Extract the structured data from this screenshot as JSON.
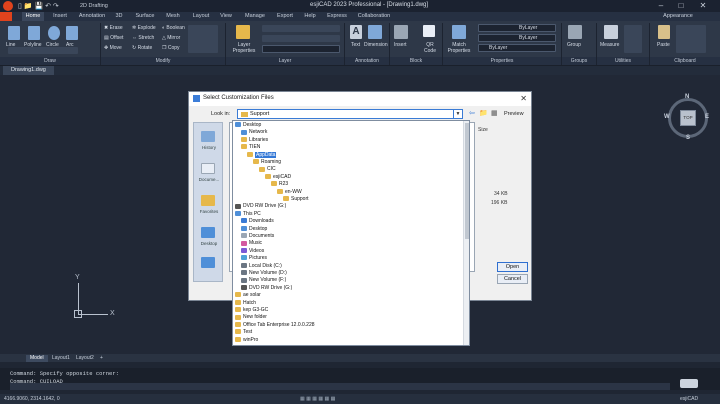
{
  "app": {
    "title": "esjiCAD 2023 Professional - [Drawing1.dwg]",
    "workspace": "2D Drafting",
    "appearance": "Appearance"
  },
  "menu_tabs": [
    "Home",
    "Insert",
    "Annotation",
    "3D",
    "Surface",
    "Mesh",
    "Layout",
    "View",
    "Manage",
    "Export",
    "Help",
    "Express",
    "Collaboration"
  ],
  "ribbon": {
    "draw": [
      "Line",
      "Polyline",
      "Circle",
      "Arc"
    ],
    "modify_col1": [
      "Erase",
      "Offset",
      "Move"
    ],
    "modify_col2": [
      "Explode",
      "Stretch",
      "Rotate"
    ],
    "modify_col3": [
      "Boolean",
      "Mirror",
      "Copy"
    ],
    "layer_label": "Layer Properties",
    "annotation": [
      "Text",
      "Dimension"
    ],
    "block": [
      "Insert",
      "QR Code"
    ],
    "match_label": "Match Properties",
    "bylayer": [
      "ByLayer",
      "ByLayer",
      "ByLayer"
    ],
    "right": [
      "Group",
      "Measure",
      "Paste"
    ],
    "groups": [
      "Draw",
      "Modify",
      "Layer",
      "Annotation",
      "Block",
      "Properties",
      "Groups",
      "Utilities",
      "Clipboard"
    ]
  },
  "document_tab": "Drawing1.dwg",
  "layout_tabs": [
    "Model",
    "Layout1",
    "Layout2",
    "+"
  ],
  "command_history": [
    "Command: Specify opposite corner:",
    "Command: CUILOAD"
  ],
  "status": {
    "coords": "4166.9060, 2314.1642, 0",
    "app": "esjiCAD"
  },
  "viewcube": {
    "top": "TOP",
    "n": "N",
    "s": "S",
    "e": "E",
    "w": "W"
  },
  "dialog": {
    "title": "Select Customization Files",
    "look_in_label": "Look in:",
    "look_in_value": "Support",
    "preview": "Preview",
    "size_header": "Size",
    "sizes": [
      "34 KB",
      "196 KB"
    ],
    "open": "Open",
    "cancel": "Cancel",
    "sidebar": [
      "History",
      "Docume...",
      "Favorites",
      "Desktop"
    ]
  },
  "tree": [
    {
      "label": "Desktop",
      "level": 0,
      "color": "#4f8fd8"
    },
    {
      "label": "Network",
      "level": 1,
      "color": "#4f8fd8"
    },
    {
      "label": "Libraries",
      "level": 1,
      "color": "#e6b84b"
    },
    {
      "label": "TIEN",
      "level": 1,
      "color": "#e6b84b"
    },
    {
      "label": "AppData",
      "level": 2,
      "color": "#e6b84b",
      "selected": true
    },
    {
      "label": "Roaming",
      "level": 3,
      "color": "#e6b84b"
    },
    {
      "label": "CIC",
      "level": 4,
      "color": "#e6b84b"
    },
    {
      "label": "esjiCAD",
      "level": 5,
      "color": "#e6b84b"
    },
    {
      "label": "R23",
      "level": 6,
      "color": "#e6b84b"
    },
    {
      "label": "en-WW",
      "level": 7,
      "color": "#e6b84b"
    },
    {
      "label": "Support",
      "level": 8,
      "color": "#e6b84b"
    },
    {
      "label": "DVD RW Drive (G:)",
      "level": 0,
      "color": "#555555"
    },
    {
      "label": "This PC",
      "level": 0,
      "color": "#4f8fd8"
    },
    {
      "label": "Downloads",
      "level": 1,
      "color": "#3a7bd5"
    },
    {
      "label": "Desktop",
      "level": 1,
      "color": "#4f8fd8"
    },
    {
      "label": "Documents",
      "level": 1,
      "color": "#9aa6b4"
    },
    {
      "label": "Music",
      "level": 1,
      "color": "#d45aa0"
    },
    {
      "label": "Videos",
      "level": 1,
      "color": "#7b5ad6"
    },
    {
      "label": "Pictures",
      "level": 1,
      "color": "#4fa3d8"
    },
    {
      "label": "Local Disk (C:)",
      "level": 1,
      "color": "#6b7683"
    },
    {
      "label": "New Volume (D:)",
      "level": 1,
      "color": "#6b7683"
    },
    {
      "label": "New Volume (F:)",
      "level": 1,
      "color": "#6b7683"
    },
    {
      "label": "DVD RW Drive (G:)",
      "level": 1,
      "color": "#555555"
    },
    {
      "label": "ae solar",
      "level": 0,
      "color": "#e6b84b"
    },
    {
      "label": "Hatch",
      "level": 0,
      "color": "#e6b84b"
    },
    {
      "label": "kep G3-GC",
      "level": 0,
      "color": "#e6b84b"
    },
    {
      "label": "New folder",
      "level": 0,
      "color": "#e6b84b"
    },
    {
      "label": "Office Tab Enterprise 12.0.0.228",
      "level": 0,
      "color": "#e6b84b"
    },
    {
      "label": "Test",
      "level": 0,
      "color": "#e6b84b"
    },
    {
      "label": "winPro",
      "level": 0,
      "color": "#e6b84b"
    }
  ],
  "colors": {
    "accent": "#3478d6",
    "logo": "#e0431d",
    "folder": "#e6b84b",
    "canvas": "#212836"
  }
}
